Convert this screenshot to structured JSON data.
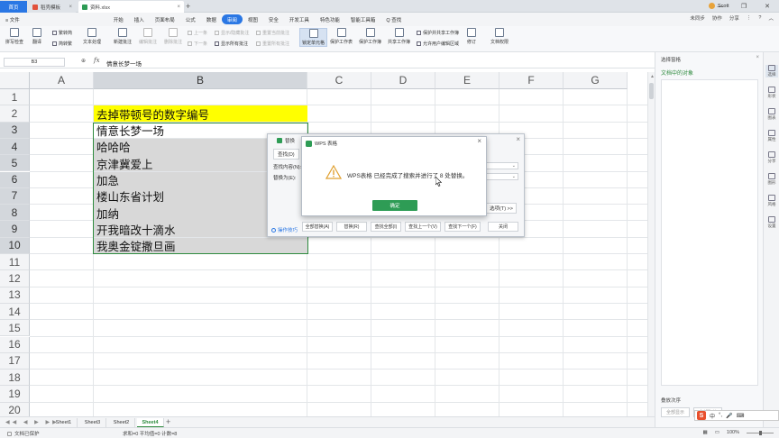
{
  "tabs": {
    "home": "首页",
    "template": "稻壳模板",
    "file": "资料.xlsx",
    "new_tab": "+"
  },
  "user": {
    "name": "Scott"
  },
  "window_buttons": {
    "min": "—",
    "max": "❐",
    "close": "✕"
  },
  "menu": {
    "file": "≡ 文件",
    "items": [
      "开始",
      "插入",
      "页面布局",
      "公式",
      "数据",
      "审阅",
      "视图",
      "安全",
      "开发工具",
      "特色功能",
      "智能工具箱",
      "Q 查找"
    ],
    "active_index": 5,
    "right": {
      "sync": "未同步",
      "coop": "协作",
      "share": "分享"
    }
  },
  "ribbon": {
    "spell": "拼写检查",
    "translate": "翻译",
    "s2t": "繁转简",
    "t2s": "简转繁",
    "textproc": "文本处理",
    "newcomment": "新建批注",
    "editcomment": "编辑批注",
    "delcomment": "删除批注",
    "prev": "上一条",
    "next": "下一条",
    "showhide": "显示/隐藏批注",
    "showall": "显示所有批注",
    "resetshape": "重置当前批注",
    "resetall": "重置所有批注",
    "lockcell": "锁定单元格",
    "protectsheet": "保护工作表",
    "protectbook": "保护工作簿",
    "sharebook": "共享工作簿",
    "protectshare": "保护并共享工作簿",
    "allowedit": "允许用户编辑区域",
    "track": "修订",
    "docperm": "文档权限"
  },
  "formula_bar": {
    "cell": "B3",
    "fx": "fx",
    "icons": "⊕",
    "content": "情意长梦一场"
  },
  "columns": [
    "A",
    "B",
    "C",
    "D",
    "E",
    "F",
    "G"
  ],
  "rows": [
    "1",
    "2",
    "3",
    "4",
    "5",
    "6",
    "7",
    "8",
    "9",
    "10",
    "11",
    "12",
    "13",
    "14",
    "15",
    "16",
    "17",
    "18",
    "19",
    "20"
  ],
  "cells": {
    "title": "去掉带顿号的数字编号",
    "items": [
      "情意长梦一场",
      "哈哈哈",
      "京津冀爱上",
      "加急",
      "楼山东省计划",
      "加纳",
      "开我暗改十滴水",
      "我奥金锭撒旦画"
    ]
  },
  "sheets": [
    "Sheet1",
    "Sheet3",
    "Sheet2",
    "Sheet4"
  ],
  "active_sheet": 3,
  "status": {
    "protect": "文档已保护",
    "stats": "求和=0 平均值=0 计数=8",
    "zoom": "100%"
  },
  "task_pane": {
    "title": "选择窗格",
    "subtitle": "文档中的对象",
    "order": "叠放次序",
    "show_all": "全部显示",
    "hide_all": "全部隐藏"
  },
  "sidebar": [
    "选择",
    "形状",
    "图表",
    "属性",
    "分享",
    "图形",
    "风格",
    "设置"
  ],
  "replace_dialog": {
    "title": "替换",
    "tab": "查找(D)",
    "find_label": "查找内容(N):",
    "replace_label": "替换为(E):",
    "options": "选项(T) >>",
    "tips": "操作技巧",
    "replace_all": "全部替换(A)",
    "replace": "替换(R)",
    "find_all": "查找全部(I)",
    "find_prev": "查找上一个(V)",
    "find_next": "查找下一个(F)",
    "close": "关闭"
  },
  "message_dialog": {
    "title": "WPS 表格",
    "message": "WPS表格 已经完成了搜索并进行了 8 处替换。",
    "ok": "确定"
  },
  "ime": {
    "logo": "S",
    "mode": "中"
  },
  "colors": {
    "accent": "#2a77e4",
    "green": "#2e9c55",
    "yellow": "#ffff00"
  }
}
